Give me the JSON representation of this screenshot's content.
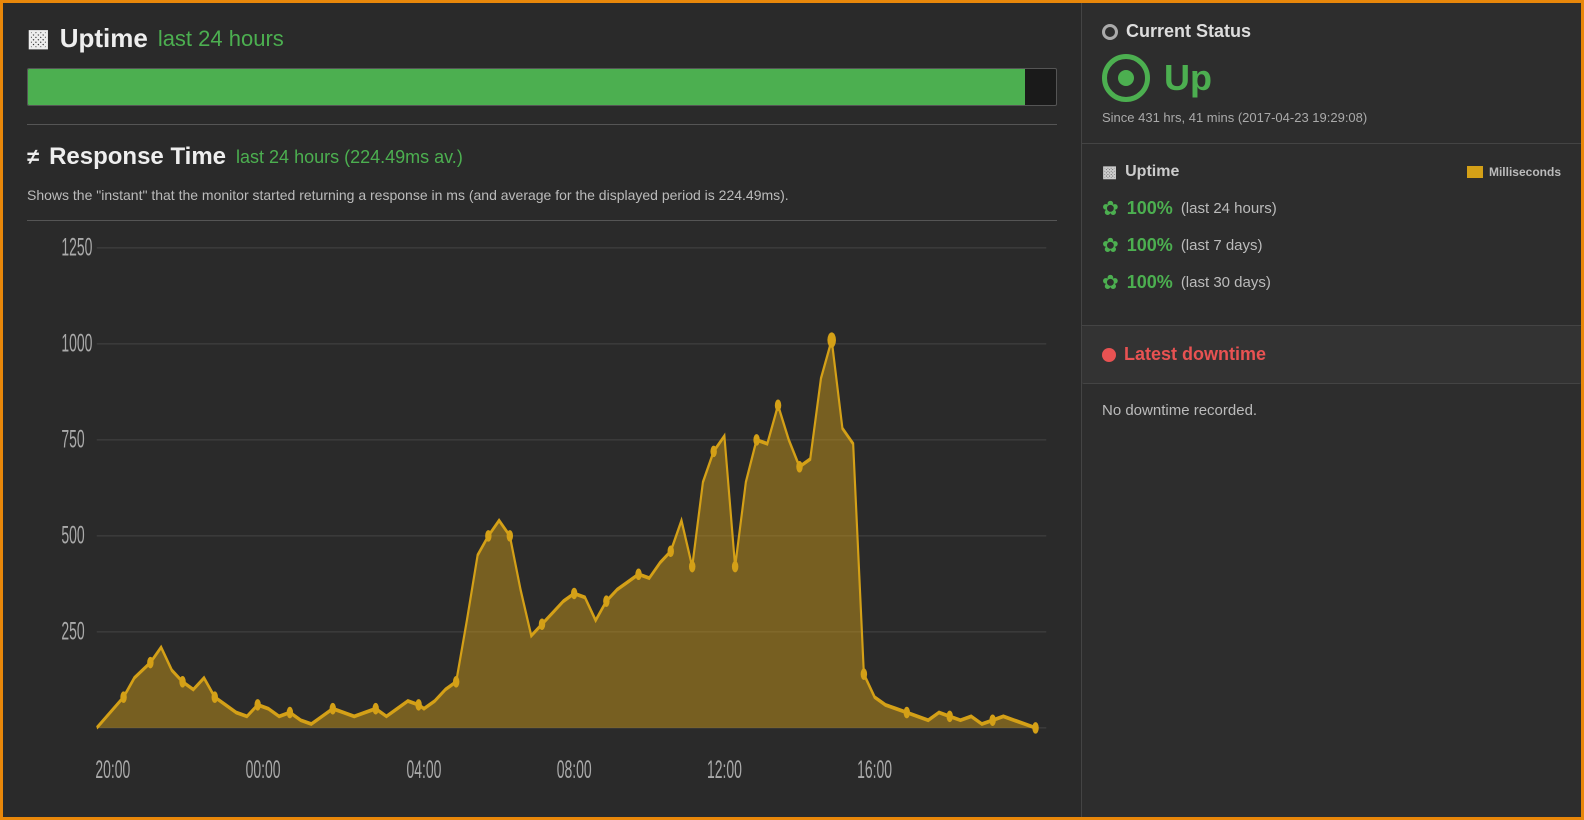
{
  "header": {
    "uptime_title": "Uptime",
    "uptime_period": "last 24 hours",
    "uptime_bar_width": "97%",
    "response_title": "Response Time",
    "response_period": "last 24 hours (224.49ms av.)",
    "response_desc": "Shows the \"instant\" that the monitor started returning a response in ms (and average for the displayed period is 224.49ms)."
  },
  "chart": {
    "y_labels": [
      "1250",
      "1000",
      "750",
      "500",
      "250",
      ""
    ],
    "x_labels": [
      "20:00",
      "00:00",
      "04:00",
      "08:00",
      "12:00",
      "16:00"
    ],
    "legend_label": "Milliseconds"
  },
  "right_panel": {
    "current_status_title": "Current Status",
    "up_label": "Up",
    "since_label": "Since 431 hrs, 41 mins (2017-04-23 19:29:08)",
    "uptime_section_title": "Uptime",
    "uptime_rows": [
      {
        "pct": "100%",
        "period": "(last 24 hours)"
      },
      {
        "pct": "100%",
        "period": "(last 7 days)"
      },
      {
        "pct": "100%",
        "period": "(last 30 days)"
      }
    ],
    "latest_downtime_title": "Latest downtime",
    "no_downtime_text": "No downtime recorded."
  }
}
